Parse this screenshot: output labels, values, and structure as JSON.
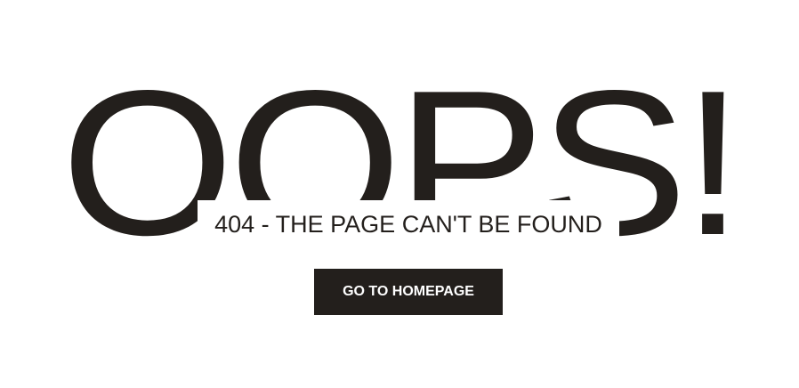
{
  "error": {
    "headline": "OOPS!",
    "message": "404 - THE PAGE CAN'T BE FOUND"
  },
  "actions": {
    "home_label": "GO TO HOMEPAGE"
  },
  "colors": {
    "text": "#231f1c",
    "background": "#ffffff",
    "button_bg": "#231f1c",
    "button_text": "#ffffff"
  }
}
